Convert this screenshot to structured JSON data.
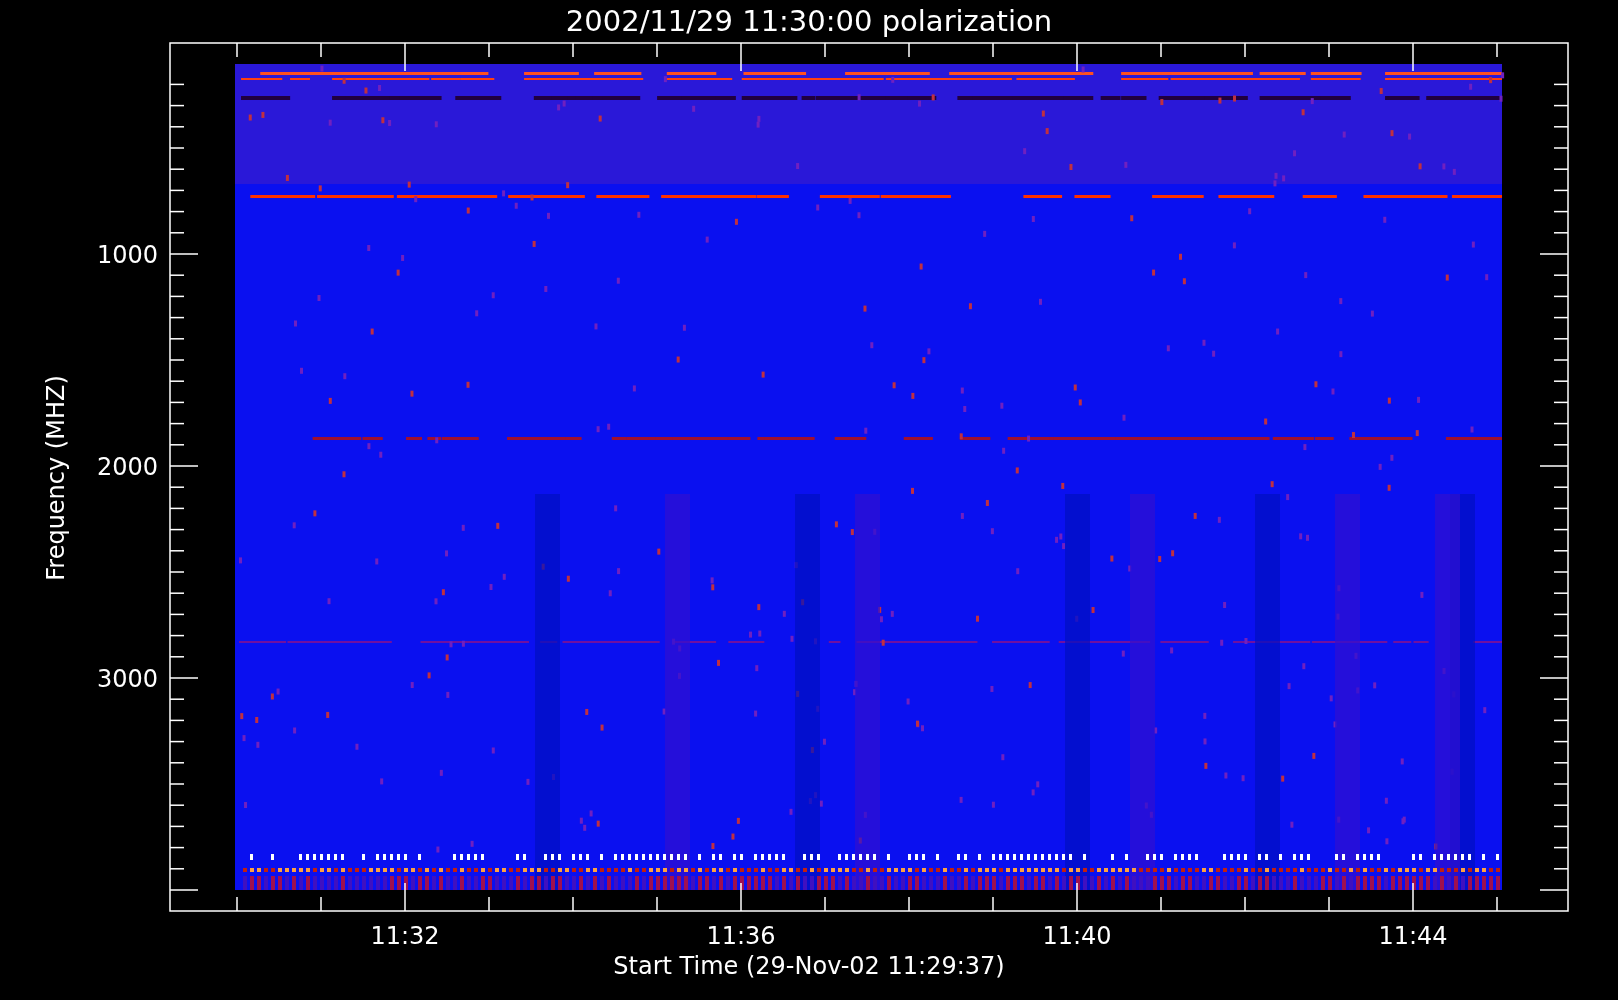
{
  "plot": {
    "title": "2002/11/29 11:30:00 polarization",
    "ylabel": "Frequency (MHZ)",
    "xlabel": "Start Time (29-Nov-02 11:29:37)",
    "yticks": [
      "1000",
      "2000",
      "3000"
    ],
    "xticks": [
      "11:32",
      "11:36",
      "11:40",
      "11:44"
    ]
  }
}
